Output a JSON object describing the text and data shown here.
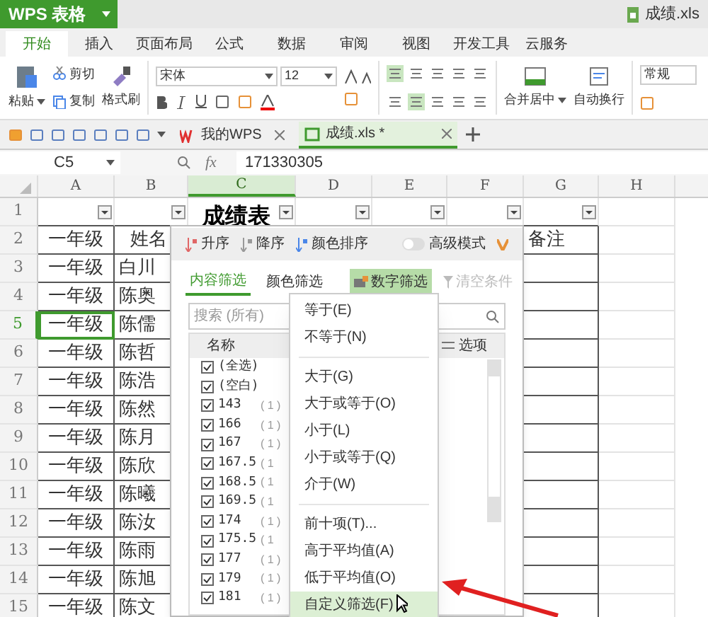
{
  "app_button": {
    "label": "WPS 表格"
  },
  "window": {
    "title": "成绩.xls"
  },
  "menu_tabs": [
    {
      "label": "开始",
      "selected": true
    },
    {
      "label": "插入",
      "selected": false
    },
    {
      "label": "页面布局",
      "selected": false
    },
    {
      "label": "公式",
      "selected": false
    },
    {
      "label": "数据",
      "selected": false
    },
    {
      "label": "审阅",
      "selected": false
    },
    {
      "label": "视图",
      "selected": false
    },
    {
      "label": "开发工具",
      "selected": false
    },
    {
      "label": "云服务",
      "selected": false
    }
  ],
  "ribbon": {
    "paste": "粘贴",
    "cut": "剪切",
    "copy": "复制",
    "format_painter": "格式刷",
    "font": "宋体",
    "size": "12",
    "merge": "合并居中",
    "wrap": "自动换行",
    "number_format": "常规"
  },
  "doc_tabs": [
    {
      "label": "我的WPS",
      "selected": false
    },
    {
      "label": "成绩.xls *",
      "selected": true
    }
  ],
  "formula_bar": {
    "cell": "C5",
    "function_label": "fx",
    "value": "171330305"
  },
  "sheet": {
    "columns": [
      {
        "label": "A",
        "selected": false
      },
      {
        "label": "B",
        "selected": false
      },
      {
        "label": "C",
        "selected": true
      },
      {
        "label": "D",
        "selected": false
      },
      {
        "label": "E",
        "selected": false
      },
      {
        "label": "F",
        "selected": false
      },
      {
        "label": "G",
        "selected": false
      },
      {
        "label": "H",
        "selected": false
      }
    ],
    "title": "成绩表",
    "title_row": {
      "number": "1",
      "selected": false
    },
    "rows": [
      {
        "number": "2",
        "selected": false,
        "a": "一年级",
        "b": "姓名",
        "g": "备注"
      },
      {
        "number": "3",
        "selected": false,
        "a": "一年级",
        "b": "白川"
      },
      {
        "number": "4",
        "selected": false,
        "a": "一年级",
        "b": "陈奥"
      },
      {
        "number": "5",
        "selected": true,
        "a": "一年级",
        "b": "陈儒"
      },
      {
        "number": "6",
        "selected": false,
        "a": "一年级",
        "b": "陈哲"
      },
      {
        "number": "7",
        "selected": false,
        "a": "一年级",
        "b": "陈浩"
      },
      {
        "number": "8",
        "selected": false,
        "a": "一年级",
        "b": "陈然"
      },
      {
        "number": "9",
        "selected": false,
        "a": "一年级",
        "b": "陈月"
      },
      {
        "number": "10",
        "selected": false,
        "a": "一年级",
        "b": "陈欣"
      },
      {
        "number": "11",
        "selected": false,
        "a": "一年级",
        "b": "陈曦"
      },
      {
        "number": "12",
        "selected": false,
        "a": "一年级",
        "b": "陈汝"
      },
      {
        "number": "13",
        "selected": false,
        "a": "一年级",
        "b": "陈雨"
      },
      {
        "number": "14",
        "selected": false,
        "a": "一年级",
        "b": "陈旭"
      },
      {
        "number": "15",
        "selected": false,
        "a": "一年级",
        "b": "陈文"
      }
    ]
  },
  "filter_popup": {
    "sort": [
      "升序",
      "降序",
      "颜色排序"
    ],
    "advanced_mode": {
      "label": "高级模式",
      "on": false
    },
    "tabs": [
      {
        "label": "内容筛选",
        "selected": true
      },
      {
        "label": "颜色筛选",
        "selected": false
      }
    ],
    "number_filter": {
      "label": "数字筛选",
      "active": true
    },
    "clear": {
      "label": "清空条件",
      "disabled": true
    },
    "search": {
      "placeholder": "搜索 (所有)"
    },
    "list_header": "名称",
    "options": "选项",
    "items": [
      {
        "label": "(全选)",
        "checked": true
      },
      {
        "label": "(空白)",
        "checked": true
      },
      {
        "label": "143",
        "count": "( 1 )",
        "checked": true
      },
      {
        "label": "166",
        "count": "( 1 )",
        "checked": true
      },
      {
        "label": "167",
        "count": "( 1 )",
        "checked": true
      },
      {
        "label": "167.5",
        "count": "( 1",
        "checked": true
      },
      {
        "label": "168.5",
        "count": "( 1",
        "checked": true
      },
      {
        "label": "169.5",
        "count": "( 1",
        "checked": true
      },
      {
        "label": "174",
        "count": "( 1 )",
        "checked": true
      },
      {
        "label": "175.5",
        "count": "( 1",
        "checked": true
      },
      {
        "label": "177",
        "count": "( 1 )",
        "checked": true
      },
      {
        "label": "179",
        "count": "( 1 )",
        "checked": true
      },
      {
        "label": "181",
        "count": "( 1 )",
        "checked": true
      }
    ]
  },
  "number_filter_menu": [
    {
      "kind": "item",
      "label": "等于(E)",
      "selected": false
    },
    {
      "kind": "item",
      "label": "不等于(N)",
      "selected": false
    },
    {
      "kind": "separator"
    },
    {
      "kind": "item",
      "label": "大于(G)",
      "selected": false
    },
    {
      "kind": "item",
      "label": "大于或等于(O)",
      "selected": false
    },
    {
      "kind": "item",
      "label": "小于(L)",
      "selected": false
    },
    {
      "kind": "item",
      "label": "小于或等于(Q)",
      "selected": false
    },
    {
      "kind": "item",
      "label": "介于(W)",
      "selected": false
    },
    {
      "kind": "separator"
    },
    {
      "kind": "item",
      "label": "前十项(T)...",
      "selected": false
    },
    {
      "kind": "item",
      "label": "高于平均值(A)",
      "selected": false
    },
    {
      "kind": "item",
      "label": "低于平均值(O)",
      "selected": false
    },
    {
      "kind": "item",
      "label": "自定义筛选(F)",
      "selected": true
    }
  ]
}
